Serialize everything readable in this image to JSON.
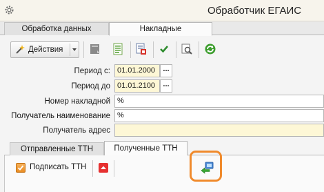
{
  "window": {
    "title": "Обработчик ЕГАИС",
    "app_icon": "gear-icon"
  },
  "main_tabs": [
    {
      "label": "Обработка данных",
      "active": false
    },
    {
      "label": "Накладные",
      "active": true
    }
  ],
  "toolbar": {
    "actions_label": "Действия",
    "actions_icon": "magic-wand-icon",
    "icons": [
      "report-icon",
      "document-list-icon",
      "print-document-icon",
      "check-icon",
      "search-document-icon",
      "refresh-icon"
    ]
  },
  "form": {
    "period_from_label": "Период с:",
    "period_from_value": "01.01.2000",
    "period_to_label": "Период до",
    "period_to_value": "01.01.2100",
    "invoice_number_label": "Номер накладной",
    "invoice_number_value": "%",
    "recipient_name_label": "Получатель наименование",
    "recipient_name_value": "%",
    "recipient_address_label": "Получатель адрес",
    "recipient_address_value": "",
    "dots_label": "..."
  },
  "sub_tabs": [
    {
      "label": "Отправленные ТТН",
      "active": false
    },
    {
      "label": "Полученные ТТН",
      "active": true
    }
  ],
  "sub_toolbar": {
    "sign_label": "Подписать ТТН",
    "sign_icon": "checkbox-icon",
    "up_icon": "arrow-up-icon",
    "import_icon": "import-arrow-icon",
    "highlight_color": "#f08a2c"
  },
  "colors": {
    "date_field_bg": "#fdf7d6",
    "accent_orange": "#f08a2c"
  }
}
